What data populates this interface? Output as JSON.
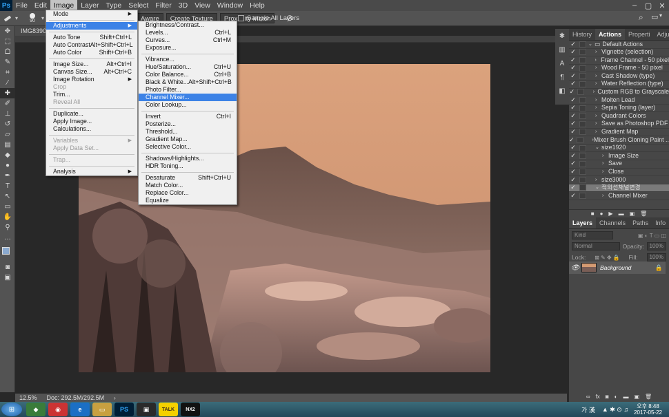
{
  "app": {
    "logo": "Ps"
  },
  "menubar": [
    "File",
    "Edit",
    "Image",
    "Layer",
    "Type",
    "Select",
    "Filter",
    "3D",
    "View",
    "Window",
    "Help"
  ],
  "options_bar": {
    "size": "90",
    "buttons": [
      "Aware",
      "Create Texture",
      "Proximity Match"
    ],
    "sample_all_layers": "Sample All Layers"
  },
  "document": {
    "tab": "IMG8390",
    "zoom": "12.5%",
    "doc_info": "Doc: 292.5M/292.5M"
  },
  "image_menu": [
    {
      "label": "Mode",
      "arrow": true
    },
    {
      "sep": true
    },
    {
      "label": "Adjustments",
      "arrow": true,
      "highlight": true
    },
    {
      "sep": true
    },
    {
      "label": "Auto Tone",
      "shortcut": "Shift+Ctrl+L"
    },
    {
      "label": "Auto Contrast",
      "shortcut": "Alt+Shift+Ctrl+L"
    },
    {
      "label": "Auto Color",
      "shortcut": "Shift+Ctrl+B"
    },
    {
      "sep": true
    },
    {
      "label": "Image Size...",
      "shortcut": "Alt+Ctrl+I"
    },
    {
      "label": "Canvas Size...",
      "shortcut": "Alt+Ctrl+C"
    },
    {
      "label": "Image Rotation",
      "arrow": true
    },
    {
      "label": "Crop",
      "disabled": true
    },
    {
      "label": "Trim..."
    },
    {
      "label": "Reveal All",
      "disabled": true
    },
    {
      "sep": true
    },
    {
      "label": "Duplicate..."
    },
    {
      "label": "Apply Image..."
    },
    {
      "label": "Calculations..."
    },
    {
      "sep": true
    },
    {
      "label": "Variables",
      "arrow": true,
      "disabled": true
    },
    {
      "label": "Apply Data Set...",
      "disabled": true
    },
    {
      "sep": true
    },
    {
      "label": "Trap...",
      "disabled": true
    },
    {
      "sep": true
    },
    {
      "label": "Analysis",
      "arrow": true
    }
  ],
  "adjustments_menu": [
    {
      "label": "Brightness/Contrast..."
    },
    {
      "label": "Levels...",
      "shortcut": "Ctrl+L"
    },
    {
      "label": "Curves...",
      "shortcut": "Ctrl+M"
    },
    {
      "label": "Exposure..."
    },
    {
      "sep": true
    },
    {
      "label": "Vibrance..."
    },
    {
      "label": "Hue/Saturation...",
      "shortcut": "Ctrl+U"
    },
    {
      "label": "Color Balance...",
      "shortcut": "Ctrl+B"
    },
    {
      "label": "Black & White...",
      "shortcut": "Alt+Shift+Ctrl+B"
    },
    {
      "label": "Photo Filter..."
    },
    {
      "label": "Channel Mixer...",
      "highlight": true
    },
    {
      "label": "Color Lookup..."
    },
    {
      "sep": true
    },
    {
      "label": "Invert",
      "shortcut": "Ctrl+I"
    },
    {
      "label": "Posterize..."
    },
    {
      "label": "Threshold..."
    },
    {
      "label": "Gradient Map..."
    },
    {
      "label": "Selective Color..."
    },
    {
      "sep": true
    },
    {
      "label": "Shadows/Highlights..."
    },
    {
      "label": "HDR Toning..."
    },
    {
      "sep": true
    },
    {
      "label": "Desaturate",
      "shortcut": "Shift+Ctrl+U"
    },
    {
      "label": "Match Color..."
    },
    {
      "label": "Replace Color..."
    },
    {
      "label": "Equalize"
    }
  ],
  "actions_panel": {
    "tabs": [
      "History",
      "Actions",
      "Properti",
      "Adjustm"
    ],
    "active_tab": "Actions",
    "rows": [
      {
        "label": "Default Actions",
        "indent": 0,
        "folder": true,
        "arrow": "v"
      },
      {
        "label": "Vignette (selection)",
        "indent": 1,
        "arrow": ">"
      },
      {
        "label": "Frame Channel - 50 pixel",
        "indent": 1,
        "arrow": ">"
      },
      {
        "label": "Wood Frame - 50 pixel",
        "indent": 1,
        "arrow": ">"
      },
      {
        "label": "Cast Shadow (type)",
        "indent": 1,
        "arrow": ">"
      },
      {
        "label": "Water Reflection (type)",
        "indent": 1,
        "arrow": ">"
      },
      {
        "label": "Custom RGB to Grayscale",
        "indent": 1,
        "arrow": ">"
      },
      {
        "label": "Molten Lead",
        "indent": 1,
        "arrow": ">"
      },
      {
        "label": "Sepia Toning (layer)",
        "indent": 1,
        "arrow": ">"
      },
      {
        "label": "Quadrant Colors",
        "indent": 1,
        "arrow": ">"
      },
      {
        "label": "Save as Photoshop PDF",
        "indent": 1,
        "arrow": ">"
      },
      {
        "label": "Gradient Map",
        "indent": 1,
        "arrow": ">"
      },
      {
        "label": "Mixer Brush Cloning Paint ...",
        "indent": 1,
        "arrow": ">"
      },
      {
        "label": "size1920",
        "indent": 1,
        "arrow": "v"
      },
      {
        "label": "Image Size",
        "indent": 2,
        "arrow": ">"
      },
      {
        "label": "Save",
        "indent": 2,
        "arrow": ">"
      },
      {
        "label": "Close",
        "indent": 2,
        "arrow": ">"
      },
      {
        "label": "size3000",
        "indent": 1,
        "arrow": ">"
      },
      {
        "label": "적외선채널변경",
        "indent": 1,
        "arrow": "v",
        "highlight": true
      },
      {
        "label": "Channel Mixer",
        "indent": 2,
        "arrow": ">"
      }
    ]
  },
  "layers_panel": {
    "tabs": [
      "Layers",
      "Channels",
      "Paths",
      "Info"
    ],
    "active_tab": "Layers",
    "kind_label": "Kind",
    "blend_mode": "Normal",
    "opacity_label": "Opacity:",
    "opacity_value": "100%",
    "lock_label": "Lock:",
    "fill_label": "Fill:",
    "fill_value": "100%",
    "layer_name": "Background"
  },
  "taskbar": {
    "apps": [
      "PS",
      "TALK",
      "NX2"
    ],
    "ime": "가 漢",
    "time": "오후 8:48",
    "date": "2017-05-22"
  },
  "colors": {
    "sky": "#d49a72",
    "accent": "#3c82e6",
    "panel": "#474747"
  }
}
